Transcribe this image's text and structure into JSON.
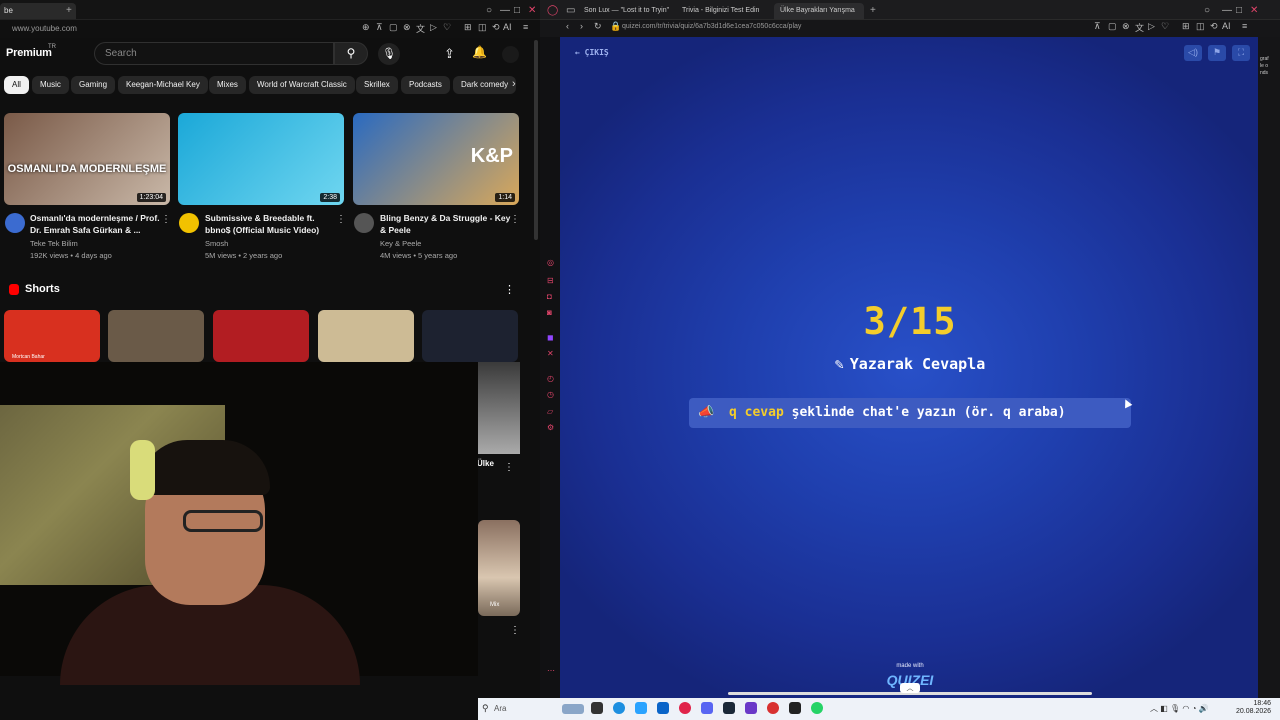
{
  "left_browser": {
    "tab_title": "be",
    "url": "www.youtube.com",
    "toolbar_extra": "AI",
    "youtube": {
      "logo": "Premium",
      "logo_sup": "TR",
      "search_placeholder": "Search",
      "chips": [
        "All",
        "Music",
        "Gaming",
        "Keegan-Michael Key",
        "Mixes",
        "World of Warcraft Classic",
        "Skrillex",
        "Podcasts",
        "Dark comedy"
      ],
      "videos": [
        {
          "title": "Osmanlı'da modernleşme / Prof. Dr. Emrah Safa Gürkan & ...",
          "channel": "Teke Tek Bilim",
          "meta": "192K views • 4 days ago",
          "duration": "1:23:04",
          "thumb_text": "OSMANLI'DA MODERNLEŞME",
          "avatar_color": "#3b6bd0",
          "thumb_colors": [
            "#7a5a48",
            "#c9b8a8"
          ]
        },
        {
          "title": "Submissive & Breedable ft. bbno$ (Official Music Video)",
          "channel": "Smosh",
          "meta": "5M views • 2 years ago",
          "duration": "2:38",
          "thumb_text": "",
          "avatar_color": "#f2c200",
          "thumb_colors": [
            "#1ba8d8",
            "#6fd6f0"
          ]
        },
        {
          "title": "Bling Benzy & Da Struggle - Key & Peele",
          "channel": "Key & Peele",
          "meta": "4M views • 5 years ago",
          "duration": "1:14",
          "thumb_text": "K&P",
          "avatar_color": "#555555",
          "thumb_colors": [
            "#2a6ac0",
            "#d9a85a"
          ]
        }
      ],
      "shorts_title": "Shorts",
      "short_thumb_colors": [
        "#d8301f",
        "#6a5a48",
        "#b21d22",
        "#cdbb95",
        "#1d2230"
      ],
      "short_first_text": "Mortcan Bahar",
      "short_partial_title": "Ülke",
      "mix_label": "Mix"
    }
  },
  "quiz_browser": {
    "tabs": [
      "Son Lux — \"Lost it to Tryin\"",
      "Trivia - Bilginizi Test Edin",
      "Ülke Bayrakları Yarışma"
    ],
    "url": "quizei.com/tr/trivia/quiz/6a7b3d1d6e1cea7c050c6cca/play",
    "toolbar_extra": "AI",
    "exit_label": "ÇIKIŞ",
    "counter": "3/15",
    "mode_label": "Yazarak Cevapla",
    "hint_highlight": "q cevap",
    "hint_rest": " şeklinde chat'e yazın (ör. q araba)",
    "made_with": "made with",
    "logo": "QUIZEI",
    "right_partial": "graf\nle o\nnds",
    "colors": {
      "accent": "#f4cd2b",
      "bg": "#1f3fae"
    }
  },
  "taskbar": {
    "search": "Ara",
    "time": "18:46",
    "date": "20.08.2026"
  }
}
